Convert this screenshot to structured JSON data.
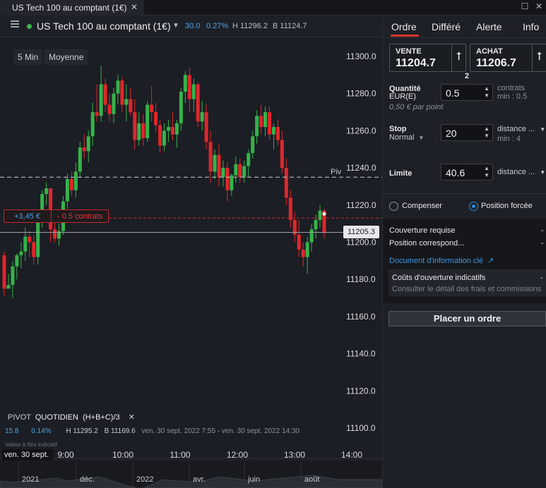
{
  "window": {
    "tab_title": "US Tech 100 au comptant (1€)",
    "close_glyph": "✕",
    "maximize_glyph": "☐",
    "close_window_glyph": "✕"
  },
  "header": {
    "instrument": "US Tech 100 au comptant (1€)",
    "caret": "▼",
    "change_points": "30.0",
    "change_percent": "0.27%",
    "high": "H 11296.2",
    "low": "B 11124.7",
    "live_color": "#3bb54a"
  },
  "chart": {
    "timeframe_button": "5 Min",
    "indicator_button": "Moyenne",
    "pivot_label": "Piv",
    "position_pnl": "+3,45 €",
    "position_size": "- 0.5 contrats",
    "current_price_label": "11205.3",
    "indicator_panel": {
      "name": "PIVOT",
      "period": "QUOTIDIEN",
      "formula": "(H+B+C)/3",
      "close": "✕",
      "value": "15.8",
      "percent": "0.14%",
      "high": "H 11295.2",
      "low": "B 11169.6",
      "range": "ven. 30 sept. 2022 7:55 - ven. 30 sept. 2022 14:30",
      "note": "Valeur à titre indicatif"
    },
    "date_label": "ven. 30 sept.",
    "overview_labels": [
      "2021",
      "déc.",
      "2022",
      "avr.",
      "juin",
      "août"
    ]
  },
  "chart_data": {
    "type": "candlestick",
    "y_ticks": [
      11300,
      11280,
      11260,
      11240,
      11220,
      11200,
      11180,
      11160,
      11140,
      11120,
      11100
    ],
    "ylim": [
      11100,
      11310
    ],
    "x_ticks": [
      "9:00",
      "10:00",
      "11:00",
      "12:00",
      "13:00",
      "14:00"
    ],
    "pivot_level": 11235,
    "position_level": 11213,
    "current_price": 11205.3,
    "up_color": "#36b34a",
    "down_color": "#e0262c",
    "candles": [
      [
        11193,
        11195,
        11171,
        11175
      ],
      [
        11175,
        11183,
        11175,
        11177
      ],
      [
        11177,
        11190,
        11170,
        11187
      ],
      [
        11187,
        11194,
        11180,
        11193
      ],
      [
        11193,
        11200,
        11186,
        11195
      ],
      [
        11195,
        11208,
        11190,
        11203
      ],
      [
        11203,
        11206,
        11192,
        11200
      ],
      [
        11200,
        11204,
        11188,
        11192
      ],
      [
        11192,
        11215,
        11188,
        11213
      ],
      [
        11213,
        11228,
        11208,
        11226
      ],
      [
        11226,
        11232,
        11220,
        11229
      ],
      [
        11229,
        11212,
        11200,
        11207
      ],
      [
        11207,
        11212,
        11200,
        11202
      ],
      [
        11202,
        11210,
        11198,
        11206
      ],
      [
        11206,
        11225,
        11204,
        11222
      ],
      [
        11222,
        11237,
        11218,
        11234
      ],
      [
        11234,
        11238,
        11225,
        11228
      ],
      [
        11228,
        11243,
        11224,
        11238
      ],
      [
        11238,
        11254,
        11235,
        11251
      ],
      [
        11251,
        11258,
        11245,
        11249
      ],
      [
        11249,
        11260,
        11243,
        11257
      ],
      [
        11257,
        11275,
        11252,
        11270
      ],
      [
        11270,
        11285,
        11265,
        11268
      ],
      [
        11268,
        11295,
        11265,
        11285
      ],
      [
        11285,
        11288,
        11270,
        11274
      ],
      [
        11274,
        11280,
        11265,
        11269
      ],
      [
        11269,
        11283,
        11264,
        11280
      ],
      [
        11280,
        11290,
        11274,
        11287
      ],
      [
        11287,
        11289,
        11270,
        11274
      ],
      [
        11274,
        11285,
        11265,
        11277
      ],
      [
        11277,
        11283,
        11268,
        11270
      ],
      [
        11270,
        11277,
        11250,
        11255
      ],
      [
        11255,
        11270,
        11252,
        11264
      ],
      [
        11264,
        11269,
        11252,
        11256
      ],
      [
        11256,
        11276,
        11254,
        11274
      ],
      [
        11274,
        11284,
        11265,
        11270
      ],
      [
        11270,
        11275,
        11259,
        11263
      ],
      [
        11263,
        11266,
        11248,
        11252
      ],
      [
        11252,
        11264,
        11249,
        11260
      ],
      [
        11260,
        11266,
        11254,
        11262
      ],
      [
        11262,
        11270,
        11255,
        11258
      ],
      [
        11258,
        11266,
        11251,
        11264
      ],
      [
        11264,
        11283,
        11260,
        11281
      ],
      [
        11281,
        11292,
        11275,
        11290
      ],
      [
        11290,
        11294,
        11270,
        11277
      ],
      [
        11277,
        11288,
        11270,
        11285
      ],
      [
        11285,
        11286,
        11262,
        11265
      ],
      [
        11265,
        11276,
        11260,
        11270
      ],
      [
        11270,
        11274,
        11250,
        11254
      ],
      [
        11254,
        11260,
        11232,
        11238
      ],
      [
        11238,
        11250,
        11234,
        11247
      ],
      [
        11247,
        11253,
        11230,
        11235
      ],
      [
        11235,
        11244,
        11230,
        11240
      ],
      [
        11240,
        11243,
        11222,
        11228
      ],
      [
        11228,
        11237,
        11225,
        11236
      ],
      [
        11236,
        11246,
        11232,
        11242
      ],
      [
        11242,
        11245,
        11232,
        11235
      ],
      [
        11235,
        11244,
        11232,
        11241
      ],
      [
        11241,
        11250,
        11235,
        11248
      ],
      [
        11248,
        11260,
        11245,
        11257
      ],
      [
        11257,
        11271,
        11253,
        11268
      ],
      [
        11268,
        11274,
        11258,
        11262
      ],
      [
        11262,
        11273,
        11257,
        11270
      ],
      [
        11270,
        11273,
        11255,
        11258
      ],
      [
        11258,
        11264,
        11250,
        11262
      ],
      [
        11262,
        11266,
        11252,
        11255
      ],
      [
        11255,
        11260,
        11237,
        11240
      ],
      [
        11240,
        11245,
        11220,
        11224
      ],
      [
        11224,
        11228,
        11208,
        11212
      ],
      [
        11212,
        11216,
        11200,
        11204
      ],
      [
        11204,
        11212,
        11192,
        11196
      ],
      [
        11196,
        11200,
        11187,
        11192
      ],
      [
        11192,
        11203,
        11183,
        11200
      ],
      [
        11200,
        11210,
        11195,
        11207
      ],
      [
        11207,
        11215,
        11202,
        11212
      ],
      [
        11212,
        11220,
        11208,
        11217
      ],
      [
        11217,
        11218,
        11202,
        11205
      ]
    ]
  },
  "panel": {
    "tabs": [
      "Ordre",
      "Différé",
      "Alerte",
      "Info"
    ],
    "sell_label": "VENTE",
    "sell_price": "11204.7",
    "buy_label": "ACHAT",
    "buy_price": "11206.7",
    "arrow": "⭡",
    "spread": "2",
    "quantity_label": "Quantité",
    "quantity_unit": "EUR(E)",
    "quantity_value": "0.5",
    "quantity_suffix": "contrats",
    "quantity_min": "min : 0.5",
    "per_point": "0,50 € par point",
    "stop_label": "Stop",
    "stop_type": "Normal",
    "stop_value": "20",
    "stop_mode": "distance ...",
    "stop_min": "min : 4",
    "limit_label": "Limite",
    "limit_value": "40.6",
    "limit_mode": "distance ...",
    "compensate_label": "Compenser",
    "forced_label": "Position forcée",
    "coverage_label": "Couverture requise",
    "coverage_value": "-",
    "position_label": "Position correspond...",
    "position_value": "-",
    "doc_link": "Document d'information clé",
    "costs_label": "Coûts d'ouverture indicatifs",
    "costs_value": "-",
    "costs_detail": "Consulter le détail des frais et commissions",
    "place_order": "Placer un ordre",
    "link_color": "#3d96e2"
  }
}
